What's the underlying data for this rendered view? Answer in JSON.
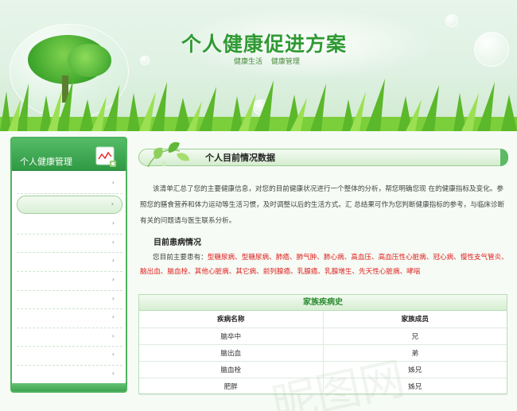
{
  "header": {
    "title": "个人健康促进方案",
    "subtitle_links": [
      "健康生活",
      "健康管理"
    ]
  },
  "sidebar": {
    "title": "个人健康管理",
    "book_icon": "health-chart-book-icon",
    "item_count": 11,
    "active_index": 1,
    "arrow_glyph": "›"
  },
  "main": {
    "section_title": "个人目前情况数据",
    "intro": "该清单汇总了您的主要健康信息，对您的目前健康状况进行一个整体的分析，帮您明确您现 在的健康指标及变化。参照您的膳食营养和体力运动等生活习惯，及时调整以后的生活方式。汇 总结果可作为您判断健康指标的参考，与临床诊断有关的问题请与医生联系分析。",
    "current_title": "目前患病情况",
    "disease_prefix": "您目前主要患有：",
    "diseases": "型糖尿病、型糖尿病、肺癌、肺气肿、肺心病、高血压、高血压性心脏病、冠心病、慢性支气管炎、脑出血、脑血栓、其他心脏病、其它病、前列腺癌、乳腺癌、乳腺增生、先天性心脏病、哮喘"
  },
  "family": {
    "title": "家族疾病史",
    "columns": [
      "疾病名称",
      "家族成员"
    ],
    "rows": [
      [
        "脑卒中",
        "兄"
      ],
      [
        "脑出血",
        "弟"
      ],
      [
        "脑血栓",
        "姊兄"
      ],
      [
        "肥胖",
        "姊兄"
      ]
    ]
  },
  "colors": {
    "brand_green": "#2f9a33",
    "sidebar_border": "#4fb35e",
    "disease_red": "#e0211f"
  }
}
